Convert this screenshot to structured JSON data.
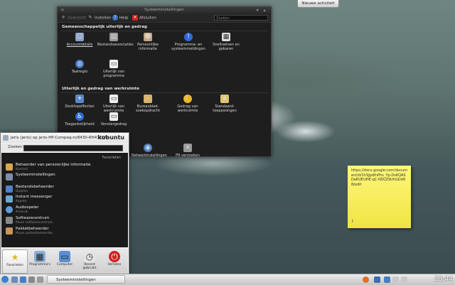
{
  "top_button": {
    "label": "Nieuwe activiteit"
  },
  "window": {
    "title": "Systeeminstellingen",
    "toolbar": {
      "overview": "Overzicht",
      "configure": "Instellen",
      "help": "Help",
      "quit": "Afsluiten",
      "search_placeholder": "Zoeken"
    },
    "section1": "Gemeenschappelijk uiterlijk en gedrag",
    "section1_items": [
      "Accountdetails",
      "Bestandsassociaties",
      "Persoonlijke informatie",
      "Programma- en systeemmeldingen",
      "Sneltoetsen en gebaren",
      "Taalregio",
      "Uiterlijk van programma"
    ],
    "section2": "Uiterlijk en gedrag van werkruimte",
    "section2_items": [
      "Desktopeffecten",
      "Uiterlijk van werkruimte",
      "Bureaublad-zoekopdracht",
      "Gedrag van werkruimte",
      "Standaard-toepassingen",
      "Toegankelijkheid",
      "Venstergedrag"
    ],
    "section3_items": [
      "Netwerkinstellingen",
      "FR verzoeken"
    ]
  },
  "kickoff": {
    "user": "jeris (jeris) op jeris-HP-Compaq-nc8430-RH471EA-",
    "brand": "kubuntu",
    "search_label": "Zoeken:",
    "favorites_title": "Favorieten",
    "items": [
      {
        "name": "Beheerder van persoonlijke informatie",
        "desc": "Kontact"
      },
      {
        "name": "Systeeminstellingen",
        "desc": ""
      },
      {
        "name": "Bestandsbeheerder",
        "desc": "Dolphin"
      },
      {
        "name": "Instant messenger",
        "desc": "Kopete"
      },
      {
        "name": "Audiospeler",
        "desc": "Amarok"
      },
      {
        "name": "Softwarecentrum",
        "desc": "Muon softwarecentrum"
      },
      {
        "name": "Pakketbeheerder",
        "desc": "Muon pakketbeheerder"
      }
    ],
    "tabs": [
      "Favorieten",
      "Programma's",
      "Computer",
      "Recent gebruikt",
      "Verlaten"
    ]
  },
  "note": {
    "text": "https://docs.google.com/document/d/1hSJpdfnPhs_Yp-DsKQASDeRUEUHE-qC-N5UZ9UhGDd98/edit"
  },
  "taskbar": {
    "task_label": "Systeeminstellingen",
    "clock": "23:44"
  },
  "colors": {
    "window_bg": "#1e1e1e",
    "note_bg": "#f7ee5a",
    "taskbar_bg": "#dcdcdc"
  }
}
